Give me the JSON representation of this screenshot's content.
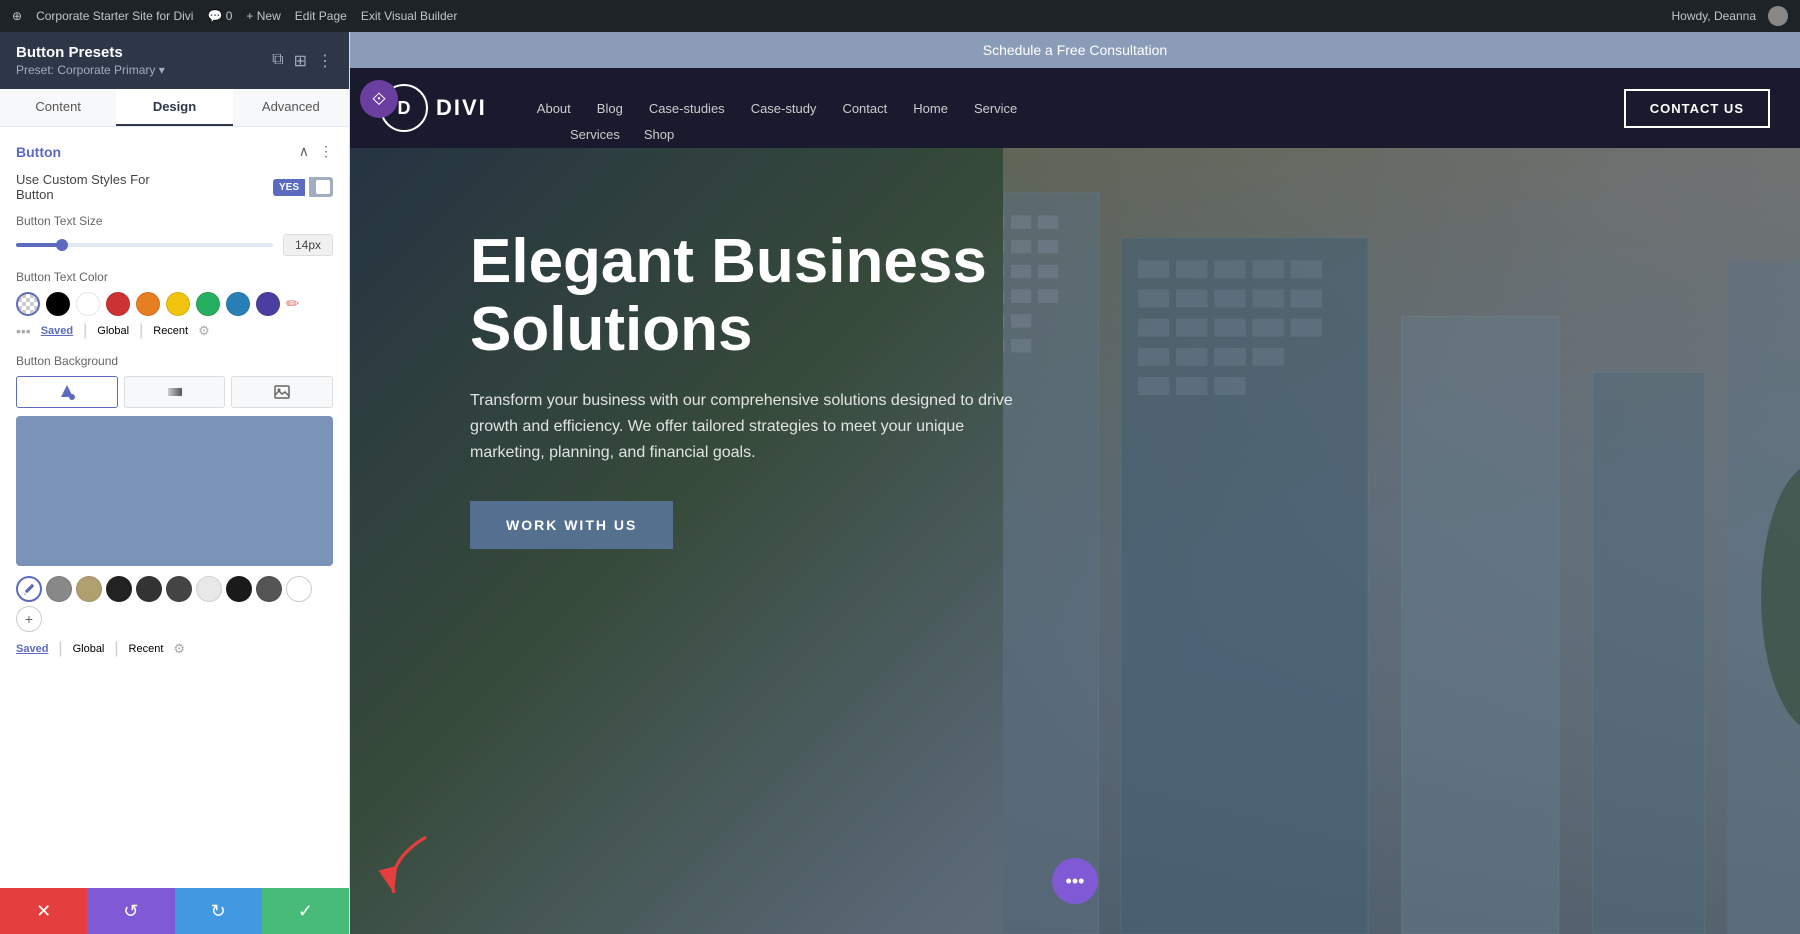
{
  "admin_bar": {
    "wp_icon": "⊕",
    "site_name": "Corporate Starter Site for Divi",
    "comments": "0",
    "new_label": "+ New",
    "edit_page": "Edit Page",
    "exit_builder": "Exit Visual Builder",
    "howdy": "Howdy, Deanna"
  },
  "left_panel": {
    "title": "Button Presets",
    "preset_label": "Preset: Corporate Primary ▾",
    "tabs": [
      "Content",
      "Design",
      "Advanced"
    ],
    "active_tab": "Design",
    "section": {
      "title": "Button",
      "use_custom_label": "Use Custom Styles For Button",
      "toggle_yes": "YES",
      "text_size_label": "Button Text Size",
      "text_size_value": "14px",
      "text_color_label": "Button Text Color",
      "bg_label": "Button Background",
      "color_tabs": [
        "Saved",
        "Global",
        "Recent"
      ]
    }
  },
  "site": {
    "notification": "Schedule a Free Consultation",
    "logo_letter": "D",
    "logo_text": "DIVI",
    "nav_items": [
      "About",
      "Blog",
      "Case-studies",
      "Case-study",
      "Contact",
      "Home",
      "Service"
    ],
    "nav_second_row": [
      "Services",
      "Shop"
    ],
    "contact_btn": "CONTACT US",
    "hero": {
      "title": "Elegant Business Solutions",
      "subtitle": "Transform your business with our comprehensive solutions designed to drive growth and efficiency. We offer tailored strategies to meet your unique marketing, planning, and financial goals.",
      "cta_label": "WORK WITH US"
    }
  },
  "action_bar": {
    "close_icon": "✕",
    "undo_icon": "↺",
    "redo_icon": "↻",
    "save_icon": "✓"
  },
  "colors": {
    "swatches": [
      "transparent",
      "#000000",
      "#ffffff",
      "#cc3333",
      "#e67e22",
      "#f1c40f",
      "#27ae60",
      "#2980b9",
      "#8e44ad",
      "#e74c3c"
    ],
    "bg_preview": "#7b93b8",
    "bottom_swatches": [
      "#888888",
      "#b0a070",
      "#222222",
      "#333333",
      "#444444",
      "#e8e8e8",
      "#1a1a1a",
      "#555555"
    ]
  }
}
